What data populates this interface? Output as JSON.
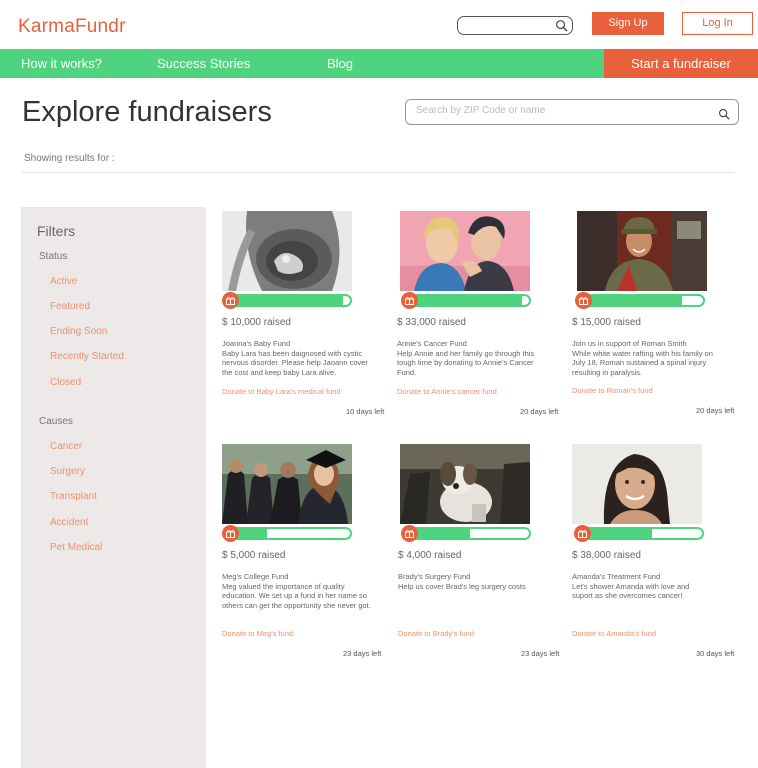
{
  "header": {
    "logo": "KarmaFundr",
    "search_placeholder": "",
    "signup_label": "Sign Up",
    "login_label": "Log In"
  },
  "nav": {
    "items": [
      {
        "label": "How it works?"
      },
      {
        "label": "Success Stories"
      },
      {
        "label": "Blog"
      }
    ],
    "cta_label": "Start a fundraiser"
  },
  "page": {
    "title": "Explore fundraisers",
    "search_placeholder": "Search by ZIP Code or name",
    "showing_text": "Showing results for :"
  },
  "filters": {
    "title": "Filters",
    "status_heading": "Status",
    "status_items": [
      "Active",
      "Featured",
      "Ending Soon",
      "Recently Started",
      "Closed"
    ],
    "causes_heading": "Causes",
    "cause_items": [
      "Cancer",
      "Surgery",
      "Transplant",
      "Accident",
      "Pet Medical"
    ]
  },
  "colors": {
    "accent": "#e8603c",
    "green": "#4fd37e",
    "link": "#ef9170",
    "sidebar_bg": "#ece9e8"
  },
  "cards": [
    {
      "raised": "$ 10,000 raised",
      "progress": 0.94,
      "name": "Joanna's Baby Fund",
      "description": "Baby Lara has been daignosed with cystic nervous disorder. Please help Jaoann cover the cost and keep baby Lara alive.",
      "donate": "Donate to Baby Lara's medical fund",
      "days": "10 days left",
      "photo": "pregnant-belly-photo"
    },
    {
      "raised": "$ 33,000 raised",
      "progress": 0.94,
      "name": "Annie's Cancer Fund",
      "description": "Help Annie and her family go through this tough time by donating to Annie's Cancer Fund.",
      "donate": "Donate to  Annie's cancer fund",
      "days": "20  days left",
      "photo": "two-women-photo"
    },
    {
      "raised": "$ 15,000 raised",
      "progress": 0.82,
      "name": "Join us in support of Roman Smith",
      "description": "While white water rafting with his family on July 18, Roman sustained a spinal injury resulting in paralysis.",
      "donate": "Donate to Roman's fund",
      "days": "20 days left",
      "photo": "soldier-photo"
    },
    {
      "raised": "$ 5,000 raised",
      "progress": 0.3,
      "name": "Meg's College Fund",
      "description": "Meg valued the importance of quality education. We set up a fund in her name so others can get the opportunity she never got.",
      "donate": "Donate to Meg's fund",
      "days": "23 days left",
      "photo": "graduation-photo"
    },
    {
      "raised": "$ 4,000 raised",
      "progress": 0.5,
      "name": "Brady's Surgery Fund",
      "description": "Help us cover Brad's leg surgery costs",
      "donate": "Donate to Brady's  fund",
      "days": "23  days left",
      "photo": "dog-photo"
    },
    {
      "raised": "$ 38,000 raised",
      "progress": 0.58,
      "name": "Amanda's Treatment Fund",
      "description": "Let's shower Amanda with love and suport as she overcomes cancer!",
      "donate": "Donate to Amanda's fund",
      "days": "30  days left",
      "photo": "woman-portrait-photo"
    }
  ]
}
